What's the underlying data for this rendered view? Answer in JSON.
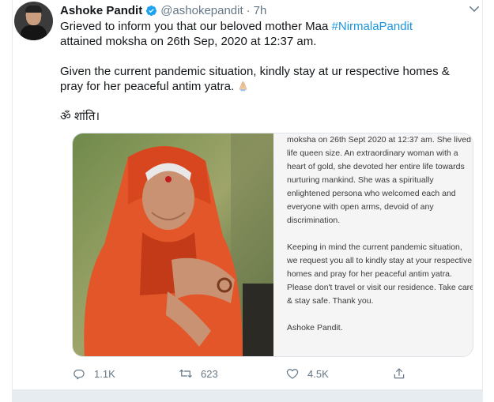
{
  "tweet": {
    "author_name": "Ashoke Pandit",
    "handle": "@ashokepandit",
    "separator": "·",
    "time": "7h",
    "text_line1_before": "Grieved to inform you that our beloved mother Maa ",
    "hashtag": "#NirmalaPandit",
    "text_line1_after": "attained moksha on 26th Sep, 2020 at 12:37 am.",
    "text_para2": "Given the current pandemic situation, kindly stay at ur respective homes & pray for her peaceful antim yatra.",
    "text_para3": "ॐ शांति।",
    "colors": {
      "link": "#1b95e0",
      "verified": "#1da1f2",
      "muted": "#657786"
    }
  },
  "media": {
    "letter_para1": "moksha on 26th Sept 2020 at 12:37 am. She lived life queen size. An extraordinary woman with a heart of gold, she devoted her entire life towards nurturing mankind. She was a spiritually enlightened persona who welcomed each and everyone with open arms, devoid of any discrimination.",
    "letter_para2": "Keeping in mind the current pandemic situation, we request you all to kindly stay at your respective homes and pray for her peaceful antim yatra. Please don't travel or visit our residence. Take care & stay safe. Thank you.",
    "letter_signature": "Ashoke Pandit."
  },
  "actions": {
    "reply_count": "1.1K",
    "retweet_count": "623",
    "like_count": "4.5K"
  },
  "icons": {
    "verified": "verified-badge-icon",
    "caret": "chevron-down-icon",
    "reply": "reply-icon",
    "retweet": "retweet-icon",
    "like": "heart-icon",
    "share": "share-icon",
    "folded_hands": "folded-hands-emoji"
  }
}
